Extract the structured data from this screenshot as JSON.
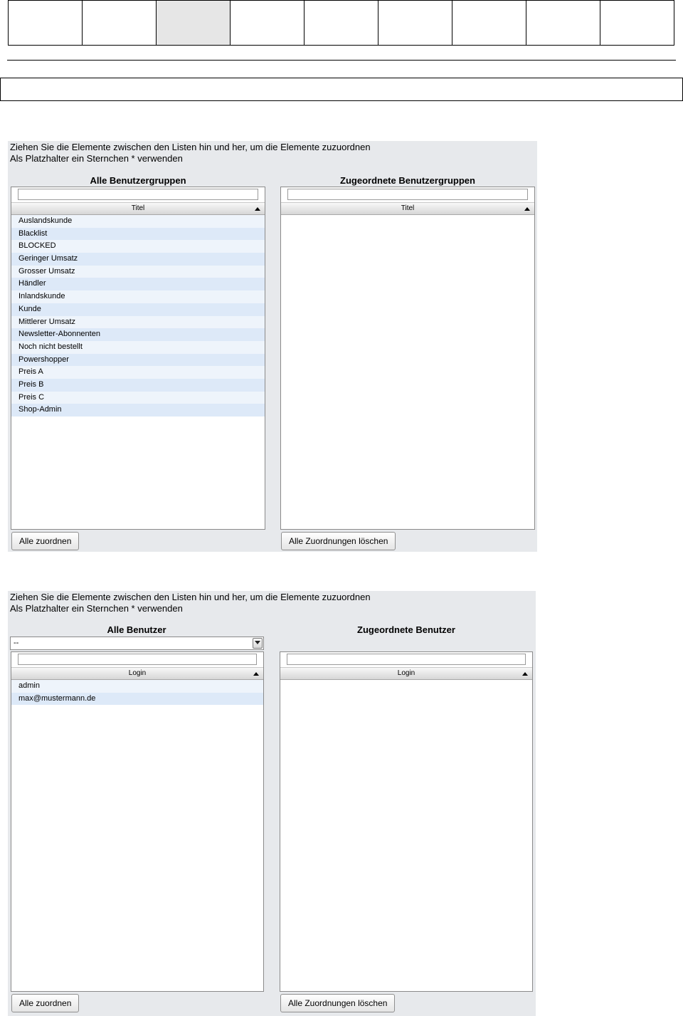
{
  "top_tabs": [
    "",
    "",
    "",
    "",
    "",
    "",
    "",
    "",
    ""
  ],
  "usergroups_panel": {
    "hint_line1": "Ziehen Sie die Elemente zwischen den Listen hin und her, um die Elemente zuzuordnen",
    "hint_line2": "Als Platzhalter ein Sternchen * verwenden",
    "left": {
      "title": "Alle Benutzergruppen",
      "filter_value": "",
      "column_header": "Titel",
      "items": [
        "Auslandskunde",
        "Blacklist",
        "BLOCKED",
        "Geringer Umsatz",
        "Grosser Umsatz",
        "Händler",
        "Inlandskunde",
        "Kunde",
        "Mittlerer Umsatz",
        "Newsletter-Abonnenten",
        "Noch nicht bestellt",
        "Powershopper",
        "Preis A",
        "Preis B",
        "Preis C",
        "Shop-Admin"
      ],
      "button": "Alle zuordnen"
    },
    "right": {
      "title": "Zugeordnete Benutzergruppen",
      "filter_value": "",
      "column_header": "Titel",
      "items": [],
      "button": "Alle Zuordnungen löschen"
    }
  },
  "users_panel": {
    "hint_line1": "Ziehen Sie die Elemente zwischen den Listen hin und her, um die Elemente zuzuordnen",
    "hint_line2": "Als Platzhalter ein Sternchen * verwenden",
    "left": {
      "title": "Alle Benutzer",
      "select_value": "--",
      "filter_value": "",
      "column_header": "Login",
      "items": [
        "admin",
        "max@mustermann.de"
      ],
      "button": "Alle zuordnen"
    },
    "right": {
      "title": "Zugeordnete Benutzer",
      "filter_value": "",
      "column_header": "Login",
      "items": [],
      "button": "Alle Zuordnungen löschen"
    }
  }
}
